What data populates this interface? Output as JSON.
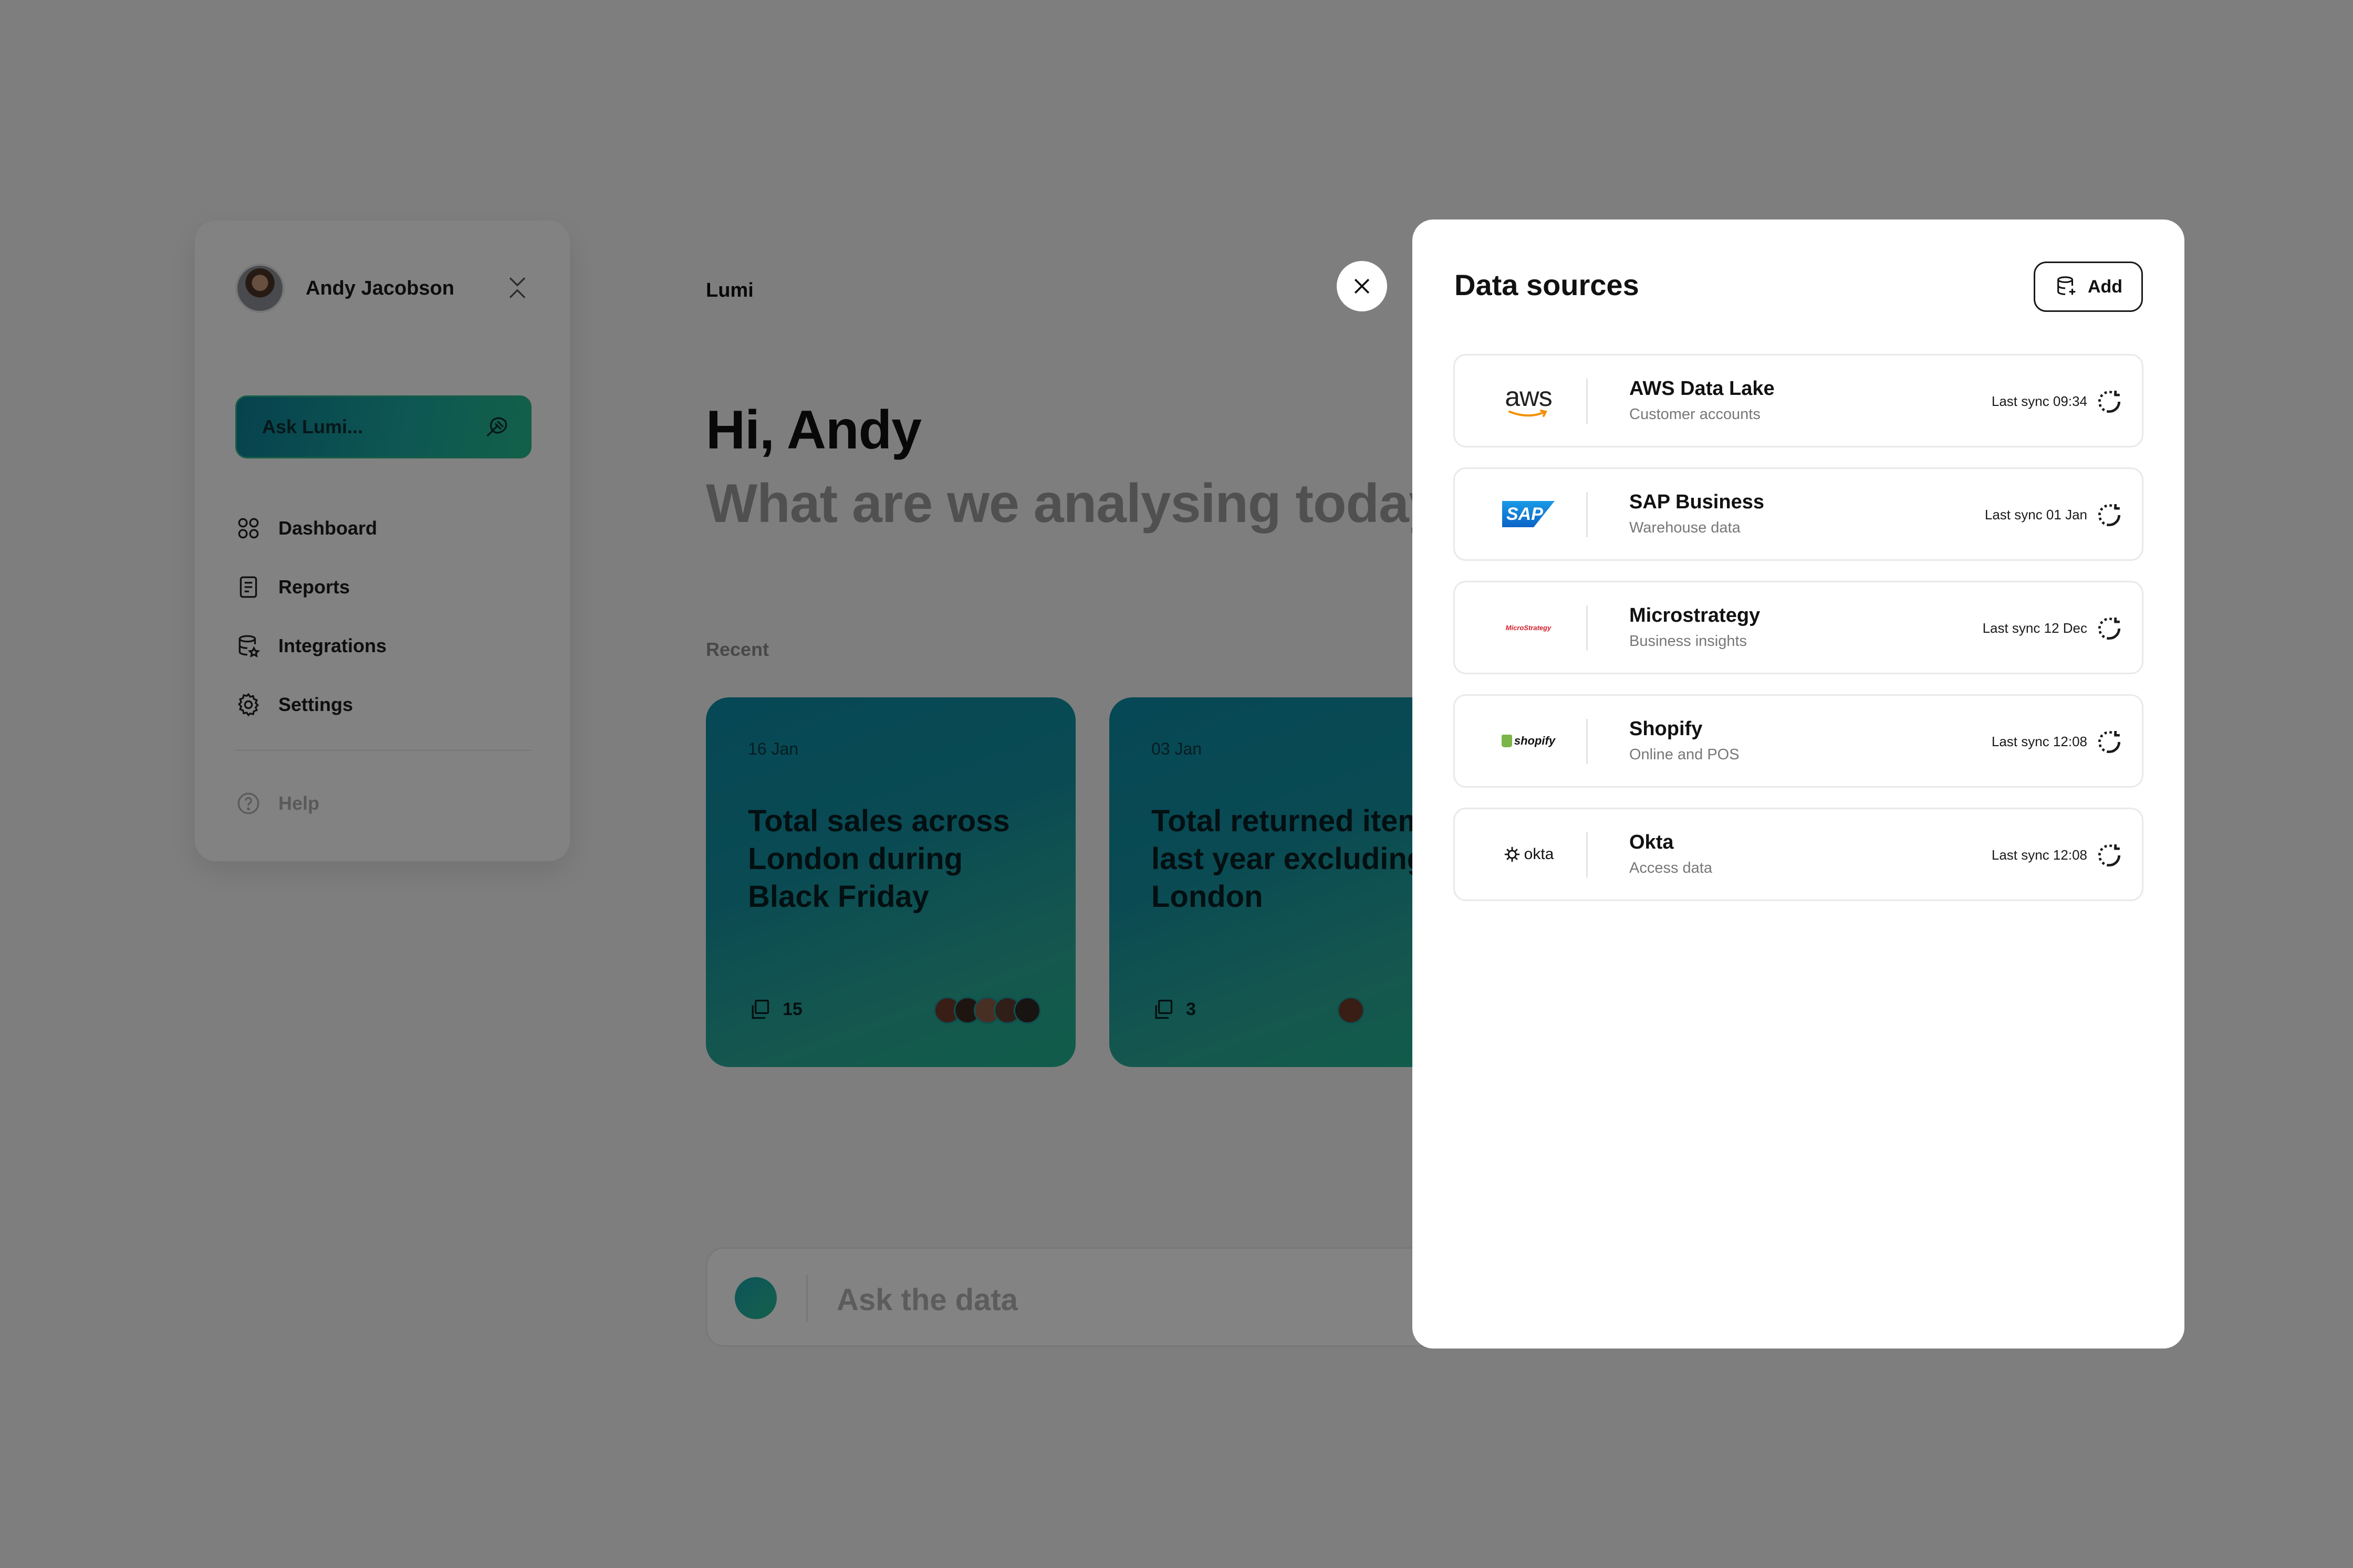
{
  "user": {
    "name": "Andy Jacobson"
  },
  "sidebar": {
    "ask_label": "Ask Lumi...",
    "items": [
      {
        "label": "Dashboard",
        "icon": "grid-icon"
      },
      {
        "label": "Reports",
        "icon": "document-icon"
      },
      {
        "label": "Integrations",
        "icon": "database-icon"
      },
      {
        "label": "Settings",
        "icon": "gear-icon"
      }
    ],
    "help_label": "Help"
  },
  "main": {
    "app_title": "Lumi",
    "greeting": "Hi, Andy",
    "subtitle": "What are we analysing today?",
    "recent_label": "Recent",
    "cards": [
      {
        "date": "16 Jan",
        "text": "Total sales across London during Black Friday",
        "count": "15"
      },
      {
        "date": "03 Jan",
        "text": "Total returned items last year excluding London",
        "count": "3"
      }
    ],
    "chat_placeholder": "Ask the data"
  },
  "panel": {
    "title": "Data sources",
    "add_label": "Add",
    "sources": [
      {
        "name": "AWS Data Lake",
        "desc": "Customer accounts",
        "sync": "Last sync 09:34",
        "logo": "aws"
      },
      {
        "name": "SAP Business",
        "desc": "Warehouse data",
        "sync": "Last sync 01 Jan",
        "logo": "SAP"
      },
      {
        "name": "Microstrategy",
        "desc": "Business insights",
        "sync": "Last sync 12 Dec",
        "logo": "MicroStrategy"
      },
      {
        "name": "Shopify",
        "desc": "Online and POS",
        "sync": "Last sync 12:08",
        "logo": "shopify"
      },
      {
        "name": "Okta",
        "desc": "Access data",
        "sync": "Last sync 12:08",
        "logo": "okta"
      }
    ]
  },
  "colors": {
    "accent_teal": "#138fa0",
    "accent_green": "#26b98d",
    "overlay": "#000000"
  }
}
